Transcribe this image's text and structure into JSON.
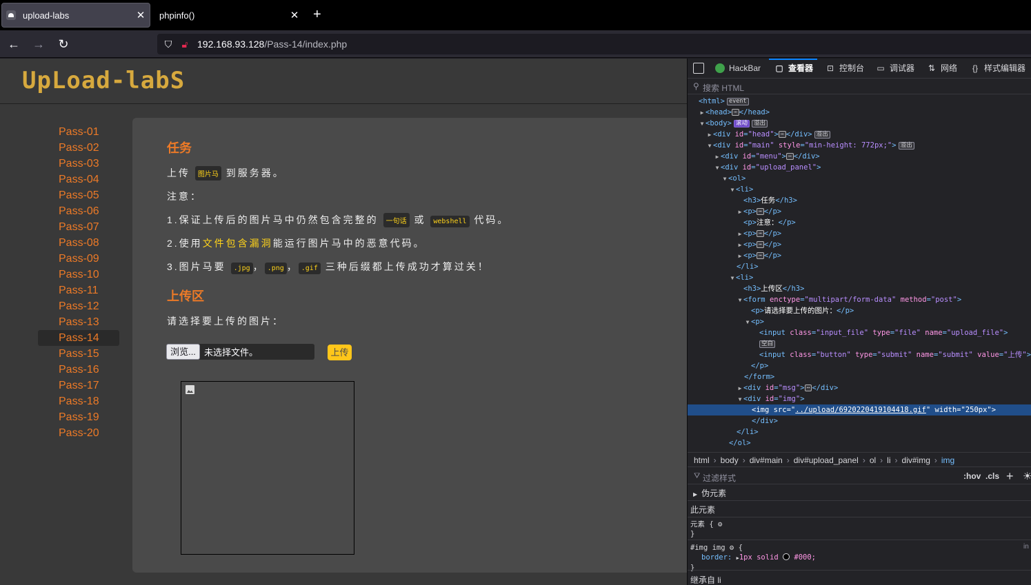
{
  "tabs": [
    {
      "title": "upload-labs",
      "active": true
    },
    {
      "title": "phpinfo()",
      "active": false
    }
  ],
  "url": {
    "host": "192.168.93.128",
    "path": "/Pass-14/index.php"
  },
  "page": {
    "logo": "UpLoad-labS",
    "menu": [
      "Pass-01",
      "Pass-02",
      "Pass-03",
      "Pass-04",
      "Pass-05",
      "Pass-06",
      "Pass-07",
      "Pass-08",
      "Pass-09",
      "Pass-10",
      "Pass-11",
      "Pass-12",
      "Pass-13",
      "Pass-14",
      "Pass-15",
      "Pass-16",
      "Pass-17",
      "Pass-18",
      "Pass-19",
      "Pass-20"
    ],
    "current": "Pass-14",
    "task_heading": "任务",
    "task_line_pre": "上传",
    "task_code": "图片马",
    "task_line_post": "到服务器。",
    "note_label": "注意：",
    "note1_pre": "1.保证上传后的图片马中仍然包含完整的",
    "note1_code1": "一句话",
    "note1_mid": "或",
    "note1_code2": "webshell",
    "note1_post": "代码。",
    "note2_pre": "2.使用",
    "note2_hl": "文件包含漏洞",
    "note2_post": "能运行图片马中的恶意代码。",
    "note3_pre": "3.图片马要",
    "note3_code1": ".jpg",
    "note3_code2": ".png",
    "note3_code3": ".gif",
    "note3_post": "三种后缀都上传成功才算过关！",
    "comma": "，",
    "upload_heading": "上传区",
    "choose_label": "请选择要上传的图片：",
    "browse_label": "浏览...",
    "file_status": "未选择文件。",
    "upload_label": "上传"
  },
  "devtools": {
    "tabs": [
      "HackBar",
      "查看器",
      "控制台",
      "调试器",
      "网络",
      "样式编辑器"
    ],
    "selected_tab": "查看器",
    "search_placeholder": "搜索 HTML",
    "badges": {
      "event": "event",
      "scroll": "滚动",
      "overflow": "溢出",
      "blank": "空白"
    },
    "tree": {
      "html": "html",
      "head": "head",
      "body": "body",
      "div_head_id": "\"head\"",
      "div_main_id": "\"main\"",
      "div_main_style": "\"min-height: 772px;\"",
      "div_menu_id": "\"menu\"",
      "div_panel_id": "\"upload_panel\"",
      "h3_task": "任务",
      "p_note": "注意：",
      "h3_upload": "上传区",
      "form_enctype": "\"multipart/form-data\"",
      "form_method": "\"post\"",
      "p_choose": "请选择要上传的图片：",
      "input1_class": "\"input_file\"",
      "input1_type": "\"file\"",
      "input1_name": "\"upload_file\"",
      "input2_class": "\"button\"",
      "input2_type": "\"submit\"",
      "input2_name": "\"submit\"",
      "input2_value": "\"上传\"",
      "div_msg_id": "\"msg\"",
      "div_img_id": "\"img\"",
      "img_src": "../upload/6920220419104418.gif",
      "img_width": "\"250px\""
    },
    "breadcrumbs": [
      "html",
      "body",
      "div#main",
      "div#upload_panel",
      "ol",
      "li",
      "div#img",
      "img"
    ],
    "rules": {
      "filter_placeholder": "过滤样式",
      "hov": ":hov",
      "cls": ".cls",
      "pseudo": "伪元素",
      "this_element": "此元素",
      "element_rule": "元素 {",
      "close": "}",
      "img_selector": "#img img",
      "img_open": "{",
      "prop": "border:",
      "v1": "1px",
      "v2": "solid",
      "v3": "#000;",
      "source": "in",
      "inherited": "继承自 li"
    }
  }
}
